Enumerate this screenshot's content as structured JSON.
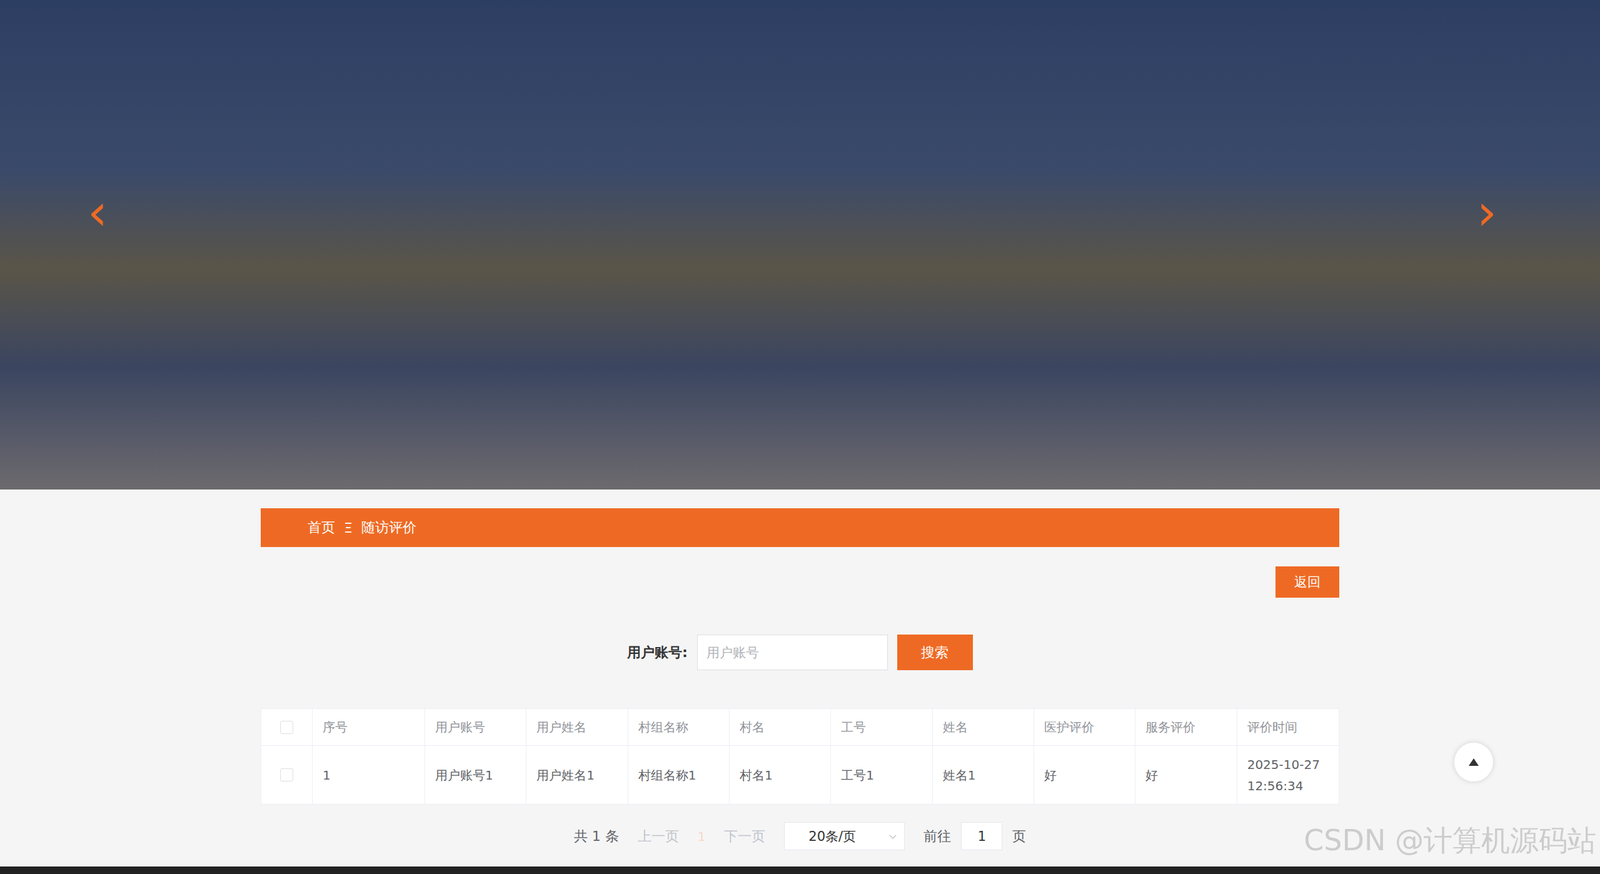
{
  "banner": {
    "prev_arrow": "‹",
    "next_arrow": "›"
  },
  "breadcrumb": {
    "items": [
      "首页",
      "随访评价"
    ],
    "separator": "Ξ"
  },
  "back_button": "返回",
  "search": {
    "label": "用户账号:",
    "placeholder": "用户账号",
    "button": "搜索"
  },
  "table": {
    "header_checked": false,
    "columns": [
      "序号",
      "用户账号",
      "用户姓名",
      "村组名称",
      "村名",
      "工号",
      "姓名",
      "医护评价",
      "服务评价",
      "评价时间"
    ],
    "rows": [
      {
        "checked": false,
        "cells": [
          "1",
          "用户账号1",
          "用户姓名1",
          "村组名称1",
          "村名1",
          "工号1",
          "姓名1",
          "好",
          "好",
          "2025-10-27 12:56:34"
        ]
      }
    ]
  },
  "pagination": {
    "total": "共 1 条",
    "prev": {
      "label": "上一页",
      "disabled": true
    },
    "pages": [
      {
        "label": "1",
        "selected": true
      }
    ],
    "next": {
      "label": "下一页",
      "disabled": true
    },
    "page_size": "20条/页",
    "goto_label": "前往",
    "goto_value": "1",
    "goto_suffix": "页"
  },
  "watermark": "CSDN @计算机源码站"
}
